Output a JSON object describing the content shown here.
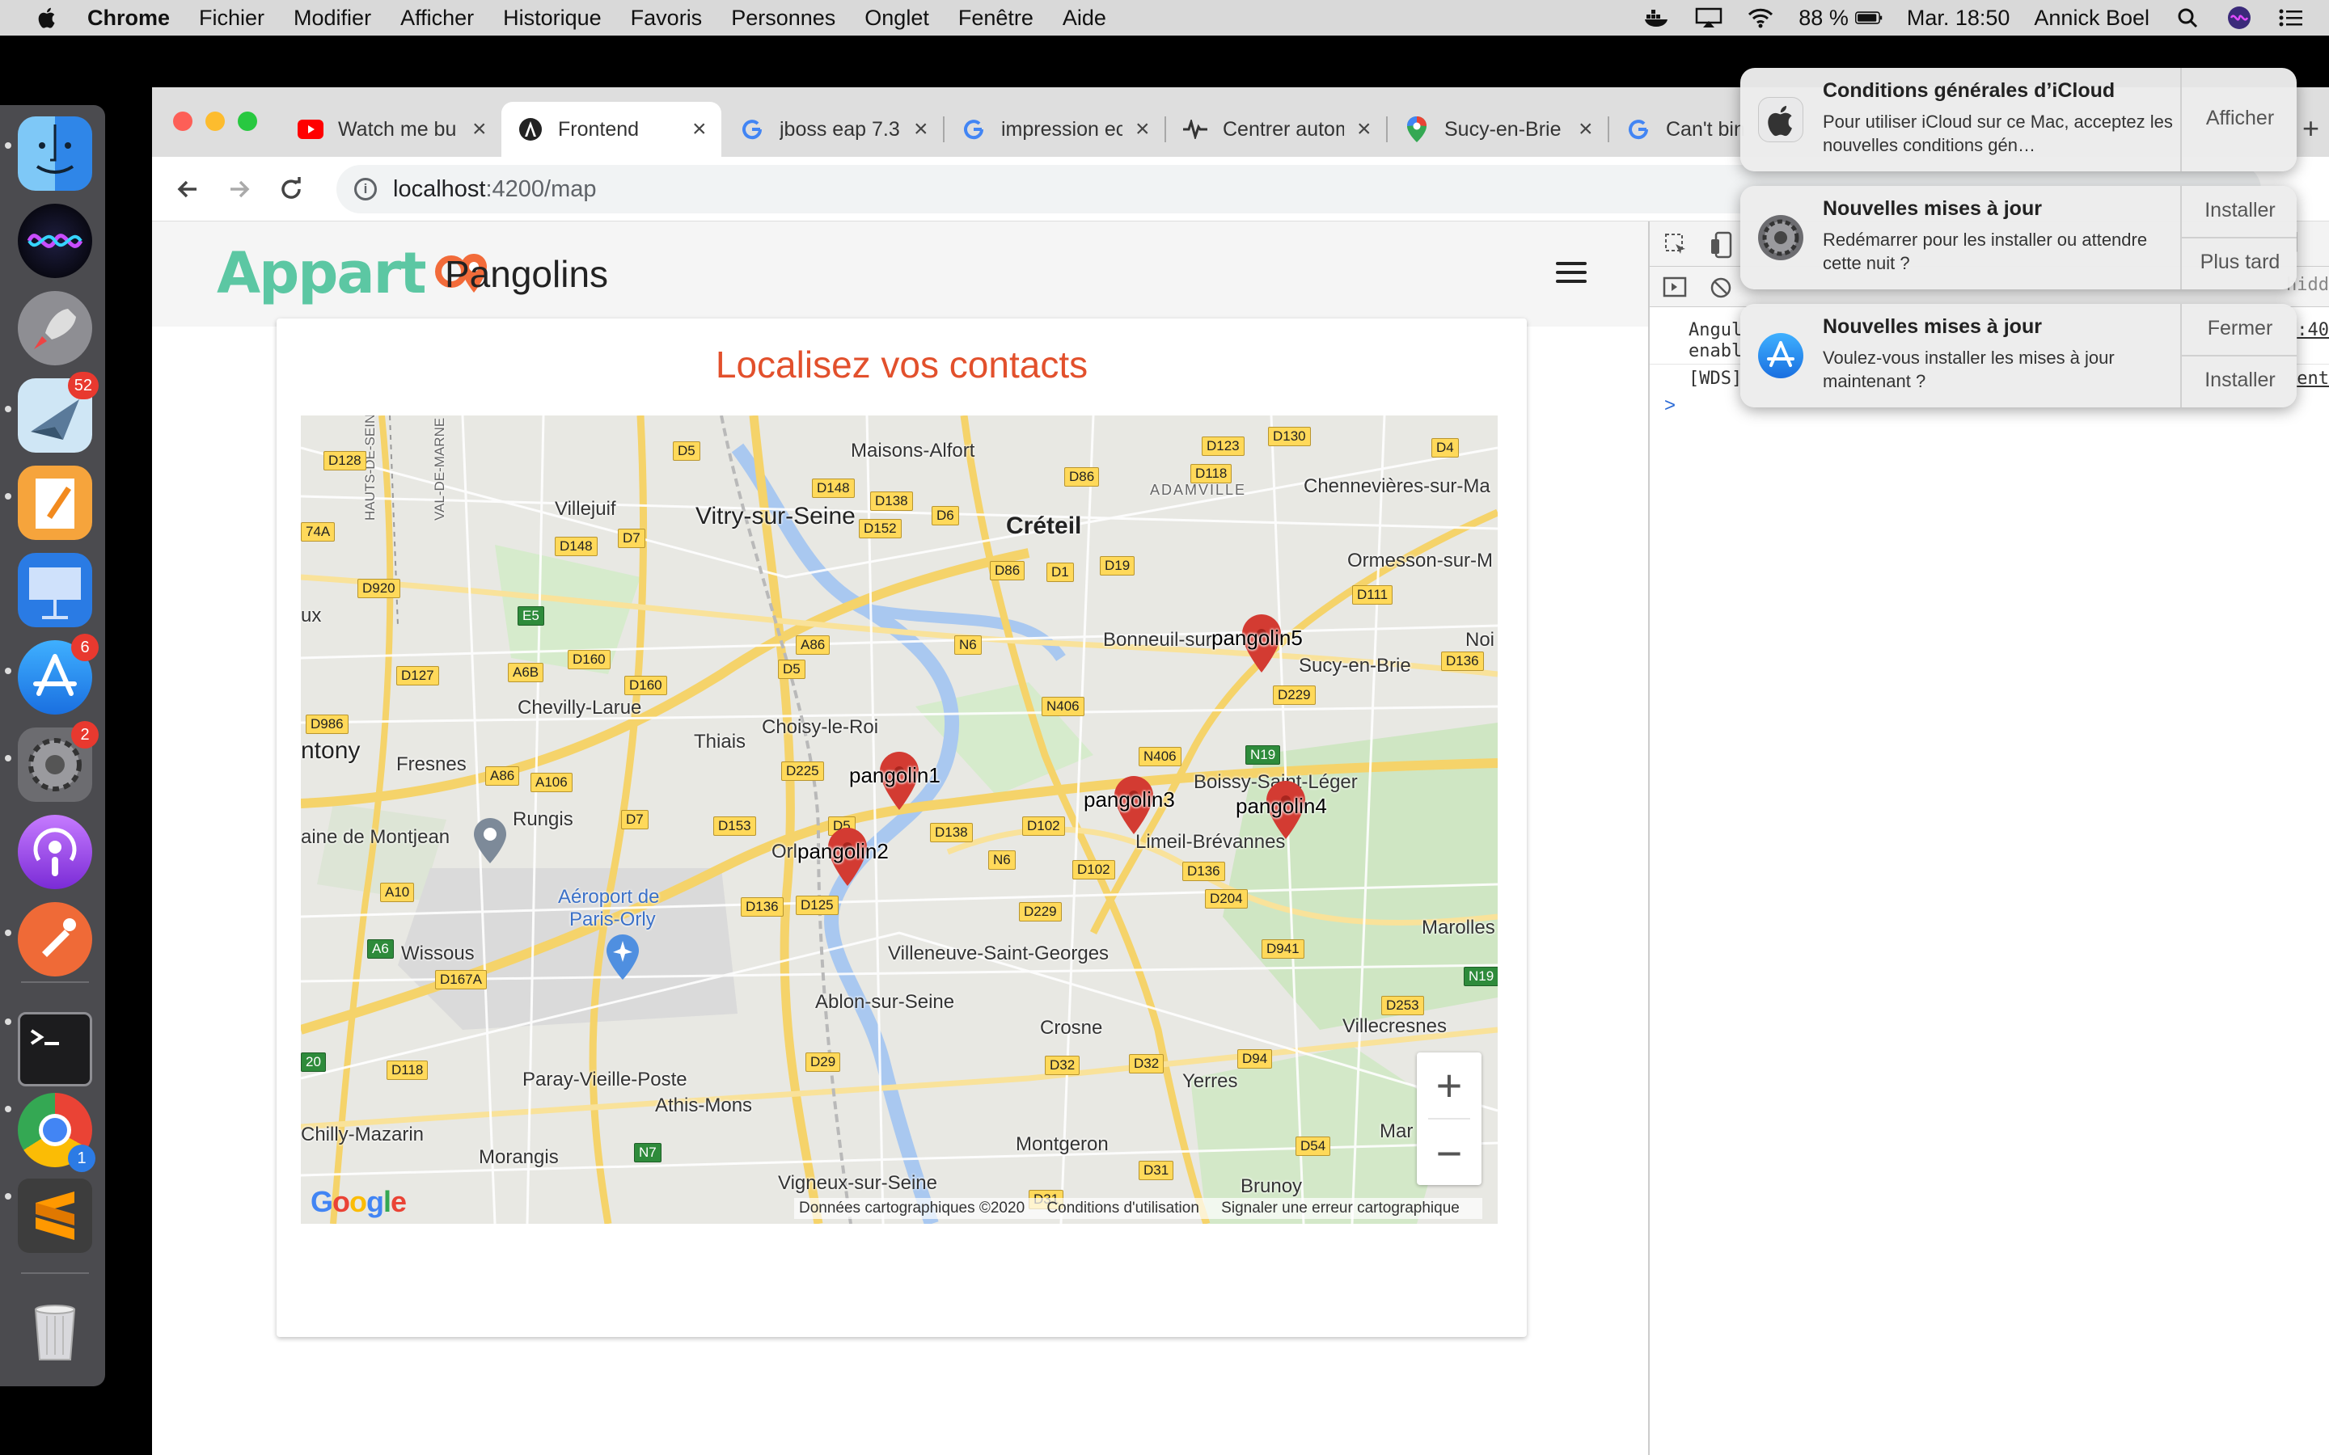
{
  "menubar": {
    "app": "Chrome",
    "items": [
      "Fichier",
      "Modifier",
      "Afficher",
      "Historique",
      "Favoris",
      "Personnes",
      "Onglet",
      "Fenêtre",
      "Aide"
    ],
    "battery": "88 %",
    "clock": "Mar. 18:50",
    "user": "Annick Boel"
  },
  "dock": {
    "badges": {
      "mail": "52",
      "appstore": "6",
      "prefs": "2",
      "chrome": "1"
    }
  },
  "tabs": [
    {
      "title": "Watch me bu"
    },
    {
      "title": "Frontend"
    },
    {
      "title": "jboss eap 7.3"
    },
    {
      "title": "impression ec"
    },
    {
      "title": "Centrer autom"
    },
    {
      "title": "Sucy-en-Brie"
    },
    {
      "title": "Can't bin"
    }
  ],
  "omnibox": {
    "host": "localhost",
    "path": ":4200/map"
  },
  "app": {
    "brand": "Pangolins",
    "logo_text": "Appart",
    "page_title": "Localisez vos contacts"
  },
  "map": {
    "places": [
      {
        "text": "Maisons-Alfort"
      },
      {
        "text": "Créteil"
      },
      {
        "text": "Vitry-sur-Seine"
      },
      {
        "text": "Villejuif"
      },
      {
        "text": "Chennevières-sur-Ma"
      },
      {
        "text": "ADAMVILLE"
      },
      {
        "text": "Ormesson-sur-M"
      },
      {
        "text": "Bonneuil-sur"
      },
      {
        "text": "Sucy-en-Brie"
      },
      {
        "text": "Noi"
      },
      {
        "text": "Chevilly-Larue"
      },
      {
        "text": "Choisy-le-Roi"
      },
      {
        "text": "Thiais"
      },
      {
        "text": "ntony"
      },
      {
        "text": "Fresnes"
      },
      {
        "text": "Rungis"
      },
      {
        "text": "aine de Montjean"
      },
      {
        "text": "Aéroport de"
      },
      {
        "text": "Paris-Orly"
      },
      {
        "text": "Orl"
      },
      {
        "text": "Boissy-Saint-Léger"
      },
      {
        "text": "Limeil-Brévannes"
      },
      {
        "text": "Villeneuve-Saint-Georges"
      },
      {
        "text": "Wissous"
      },
      {
        "text": "Ablon-sur-Seine"
      },
      {
        "text": "Crosne"
      },
      {
        "text": "Marolles"
      },
      {
        "text": "Villecresnes"
      },
      {
        "text": "Paray-Vieille-Poste"
      },
      {
        "text": "Athis-Mons"
      },
      {
        "text": "Yerres"
      },
      {
        "text": "Chilly-Mazarin"
      },
      {
        "text": "Morangis"
      },
      {
        "text": "Montgeron"
      },
      {
        "text": "Mar"
      },
      {
        "text": "Vigneux-sur-Seine"
      },
      {
        "text": "Brunoy"
      },
      {
        "text": "ux"
      },
      {
        "text": "HAUTS-DE-SEIN"
      },
      {
        "text": "VAL-DE-MARNE"
      }
    ],
    "roads": [
      {
        "text": "D128"
      },
      {
        "text": "D5"
      },
      {
        "text": "D148"
      },
      {
        "text": "D138"
      },
      {
        "text": "D152"
      },
      {
        "text": "D6"
      },
      {
        "text": "D123"
      },
      {
        "text": "D130"
      },
      {
        "text": "D4"
      },
      {
        "text": "D86"
      },
      {
        "text": "D118"
      },
      {
        "text": "D148"
      },
      {
        "text": "D7"
      },
      {
        "text": "74A"
      },
      {
        "text": "D920"
      },
      {
        "text": "E5"
      },
      {
        "text": "D86"
      },
      {
        "text": "D1"
      },
      {
        "text": "D19"
      },
      {
        "text": "D111"
      },
      {
        "text": "D160"
      },
      {
        "text": "A86"
      },
      {
        "text": "N6"
      },
      {
        "text": "D127"
      },
      {
        "text": "A6B"
      },
      {
        "text": "D160"
      },
      {
        "text": "D5"
      },
      {
        "text": "D136"
      },
      {
        "text": "D229"
      },
      {
        "text": "N406"
      },
      {
        "text": "D986"
      },
      {
        "text": "A86"
      },
      {
        "text": "A106"
      },
      {
        "text": "D225"
      },
      {
        "text": "N406"
      },
      {
        "text": "N19"
      },
      {
        "text": "D7"
      },
      {
        "text": "D153"
      },
      {
        "text": "D5"
      },
      {
        "text": "D138"
      },
      {
        "text": "D102"
      },
      {
        "text": "N6"
      },
      {
        "text": "D102"
      },
      {
        "text": "D136"
      },
      {
        "text": "A10"
      },
      {
        "text": "D136"
      },
      {
        "text": "D125"
      },
      {
        "text": "D229"
      },
      {
        "text": "D204"
      },
      {
        "text": "A6"
      },
      {
        "text": "D167A"
      },
      {
        "text": "D941"
      },
      {
        "text": "N19"
      },
      {
        "text": "D253"
      },
      {
        "text": "20"
      },
      {
        "text": "D118"
      },
      {
        "text": "D29"
      },
      {
        "text": "D32"
      },
      {
        "text": "D32"
      },
      {
        "text": "D94"
      },
      {
        "text": "N7"
      },
      {
        "text": "D54"
      },
      {
        "text": "D31"
      },
      {
        "text": "D31"
      }
    ],
    "markers": [
      {
        "label": "pangolin1"
      },
      {
        "label": "pangolin2"
      },
      {
        "label": "pangolin3"
      },
      {
        "label": "pangolin4"
      },
      {
        "label": "pangolin5"
      }
    ],
    "zoom_in": "+",
    "zoom_out": "−",
    "google": "Google",
    "attribution": {
      "data": "Données cartographiques ©2020",
      "terms": "Conditions d'utilisation",
      "report": "Signaler une erreur cartographique"
    }
  },
  "devtools": {
    "lines": [
      "Angul",
      "enabl",
      "[WDS]"
    ],
    "right_snips": [
      ":40",
      "hidd",
      "ent"
    ],
    "prompt": ">"
  },
  "notifications": [
    {
      "title": "Conditions générales d’iCloud",
      "body": "Pour utiliser iCloud sur ce Mac, acceptez les nouvelles conditions gén…",
      "actions": [
        "Afficher"
      ]
    },
    {
      "title": "Nouvelles mises à jour",
      "body": "Redémarrer pour les installer ou attendre cette nuit ?",
      "actions": [
        "Installer",
        "Plus tard"
      ]
    },
    {
      "title": "Nouvelles mises à jour",
      "body": "Voulez-vous installer les mises à jour maintenant ?",
      "actions": [
        "Fermer",
        "Installer"
      ]
    }
  ],
  "colors": {
    "accent_title": "#e2502c",
    "logo_green": "#5cc7a3",
    "logo_orange": "#f26b3a",
    "marker_red": "#d33b32"
  }
}
